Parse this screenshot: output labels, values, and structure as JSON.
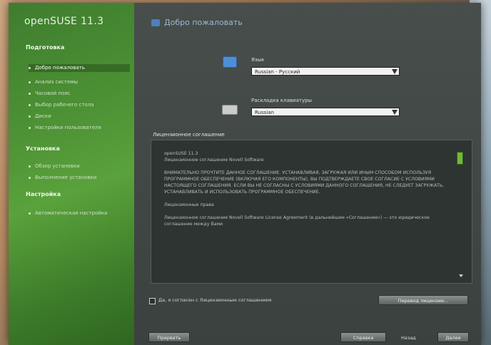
{
  "app": {
    "title": "openSUSE 11.3"
  },
  "sidebar": {
    "sections": [
      {
        "label": "Подготовка"
      },
      {
        "label": "Установка"
      },
      {
        "label": "Настройка"
      }
    ],
    "steps": [
      {
        "label": "Добро пожаловать"
      },
      {
        "label": "Анализ системы"
      },
      {
        "label": "Часовой пояс"
      },
      {
        "label": "Выбор рабочего стола"
      },
      {
        "label": "Диски"
      },
      {
        "label": "Настройки пользователя"
      },
      {
        "label": "Обзор установки"
      },
      {
        "label": "Выполнение установки"
      },
      {
        "label": "Автоматическая настройка"
      }
    ]
  },
  "main": {
    "title": "Добро пожаловать",
    "language": {
      "label": "Язык",
      "value": "Russian - Русский"
    },
    "keyboard": {
      "label": "Раскладка клавиатуры",
      "value": "Russian"
    },
    "license": {
      "heading": "Лицензионное соглашение",
      "paragraphs": [
        "openSUSE 11.3\nЛицензионное соглашение Novell Software",
        "ВНИМАТЕЛЬНО ПРОЧТИТЕ ДАННОЕ СОГЛАШЕНИЕ. УСТАНАВЛИВАЯ, ЗАГРУЖАЯ ИЛИ ИНЫМ СПОСОБОМ ИСПОЛЬЗУЯ ПРОГРАММНОЕ ОБЕСПЕЧЕНИЕ (ВКЛЮЧАЯ ЕГО КОМПОНЕНТЫ), ВЫ ПОДТВЕРЖДАЕТЕ СВОЕ СОГЛАСИЕ С УСЛОВИЯМИ НАСТОЯЩЕГО СОГЛАШЕНИЯ. ЕСЛИ ВЫ НЕ СОГЛАСНЫ С УСЛОВИЯМИ ДАННОГО СОГЛАШЕНИЯ, НЕ СЛЕДУЕТ ЗАГРУЖАТЬ, УСТАНАВЛИВАТЬ И ИСПОЛЬЗОВАТЬ ПРОГРАММНОЕ ОБЕСПЕЧЕНИЕ.",
        "Лицензионные права",
        "Лицензионное соглашение Novell Software License Agreement (в дальнейшем «Соглашение») — это юридическое соглашение между Вами"
      ]
    },
    "accept_checkbox": {
      "label": "Да, я согласен с Лицензионным соглашением",
      "checked": false
    },
    "license_translations_button": "Перевод лицензии...",
    "buttons": {
      "abort": "Прервать",
      "help": "Справка",
      "back": "Назад",
      "next": "Далее"
    }
  }
}
